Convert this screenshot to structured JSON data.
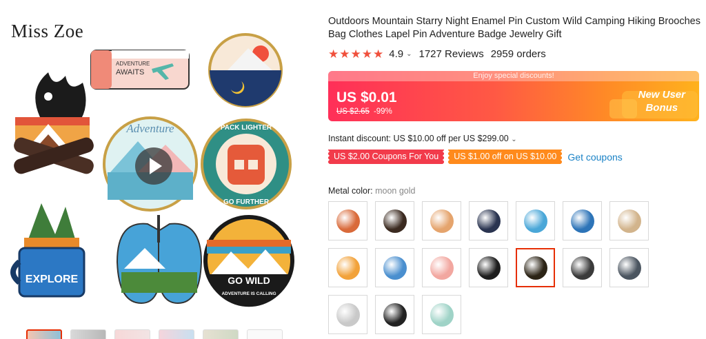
{
  "brand": "Miss Zoe",
  "gallery": {
    "pins": {
      "adventure_awaits_line1": "ADVENTURE",
      "adventure_awaits_line2": "AWAITS",
      "adventure_script": "Adventure",
      "pack_lighter_top": "PACK LIGHTER",
      "pack_lighter_bottom": "GO FURTHER",
      "explore": "EXPLORE",
      "go_wild": "GO WILD",
      "go_wild_sub": "ADVENTURE IS CALLING"
    },
    "thumbnail_count": 6
  },
  "product": {
    "title": "Outdoors Mountain Starry Night Enamel Pin Custom Wild Camping Hiking Brooches Bag Clothes Lapel Pin Adventure Badge Jewelry Gift",
    "rating": "4.9",
    "stars": 5,
    "reviews": "1727 Reviews",
    "orders": "2959 orders"
  },
  "promo": {
    "banner_top": "Enjoy special discounts!",
    "price": "US $0.01",
    "original_price": "US $2.65",
    "discount": "-99%",
    "badge_line1": "New User",
    "badge_line2": "Bonus"
  },
  "instant_discount": "Instant discount: US $10.00 off per US $299.00",
  "coupons": {
    "red": "US $2.00 Coupons For You",
    "orange": "US $1.00 off on US $10.00",
    "link": "Get coupons"
  },
  "metal_color": {
    "label": "Metal color: ",
    "value": "moon gold"
  },
  "swatches": [
    {
      "name": "campfire-orange",
      "color": "#d96a3a"
    },
    {
      "name": "campfire",
      "color": "#3b2a20"
    },
    {
      "name": "mountain-sunset",
      "color": "#e5a46d"
    },
    {
      "name": "starry-mountain",
      "color": "#2a3450"
    },
    {
      "name": "lungs",
      "color": "#4aa7d8"
    },
    {
      "name": "explore-mug",
      "color": "#2d74b8"
    },
    {
      "name": "ticket",
      "color": "#d2b48c"
    },
    {
      "name": "go-wild",
      "color": "#f2a23a"
    },
    {
      "name": "ticket-blue",
      "color": "#4a8fcf"
    },
    {
      "name": "adventure-ticket",
      "color": "#f2a7a0"
    },
    {
      "name": "night-moon",
      "color": "#1e1e1e"
    },
    {
      "name": "moon-gold",
      "color": "#2c2416"
    },
    {
      "name": "mountain-bw",
      "color": "#3a3a3a"
    },
    {
      "name": "mountain-grey",
      "color": "#4b5560"
    },
    {
      "name": "hourglass",
      "color": "#c9c9c9"
    },
    {
      "name": "bear",
      "color": "#222222"
    },
    {
      "name": "round-landscape",
      "color": "#9fd3c7"
    }
  ],
  "selected_swatch": 11
}
